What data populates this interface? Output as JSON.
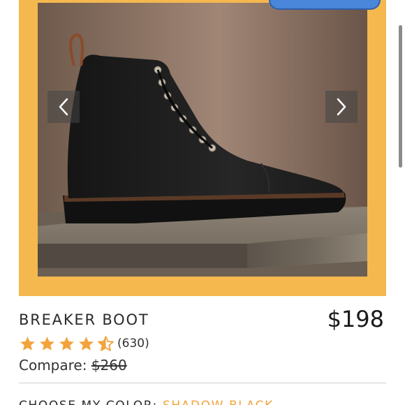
{
  "gallery": {
    "image_alt": "Black leather lace-up boot on stone pedestal",
    "prev_icon": "chevron-left-icon",
    "next_icon": "chevron-right-icon",
    "frame_color": "#f5b84f"
  },
  "product": {
    "title": "BREAKER BOOT",
    "price": "$198",
    "rating": 4.5,
    "review_count": "(630)",
    "compare_label": "Compare:",
    "compare_price": "$260",
    "star_color": "#f2a33c"
  },
  "color_selector": {
    "label": "CHOOSE MY COLOR:",
    "selected": "SHADOW BLACK",
    "accent": "#f2a33c"
  }
}
